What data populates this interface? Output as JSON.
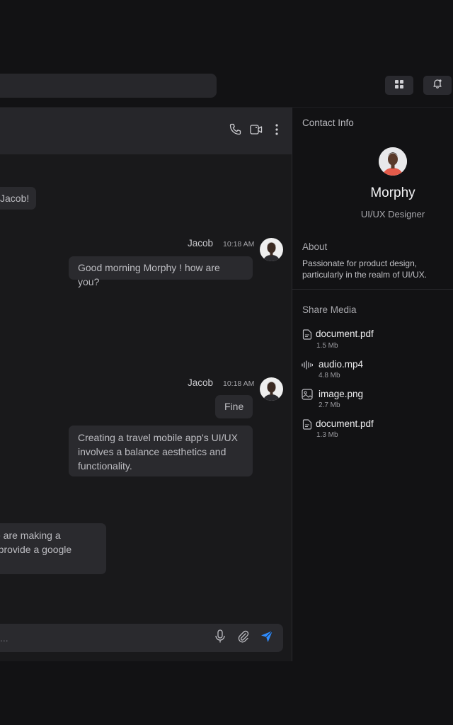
{
  "chat": {
    "messages": [
      {
        "text": "Jacob!"
      },
      {
        "sender": "Jacob",
        "time": "10:18 AM",
        "text": "Good morning Morphy ! how are you?"
      },
      {
        "sender": "Jacob",
        "time": "10:18 AM",
        "text": "Fine"
      },
      {
        "text": "Creating a travel mobile app's UI/UX involves a balance aesthetics and functionality."
      },
      {
        "line1": "ve are making a",
        "line2": "e provide a  google"
      }
    ],
    "input_placeholder": "..."
  },
  "panel": {
    "title": "Contact Info",
    "name": "Morphy",
    "role": "UI/UX Designer",
    "about_title": "About",
    "about_text": "Passionate for product design, particularly in the realm of UI/UX.",
    "media_title": "Share Media",
    "files": [
      {
        "name": "document.pdf",
        "size": "1.5 Mb",
        "icon": "document-icon"
      },
      {
        "name": "audio.mp4",
        "size": "4.8 Mb",
        "icon": "audio-icon"
      },
      {
        "name": "image.png",
        "size": "2.7 Mb",
        "icon": "image-icon"
      },
      {
        "name": "document.pdf",
        "size": "1.3 Mb",
        "icon": "document-icon"
      }
    ]
  },
  "colors": {
    "accent": "#2f8cff",
    "background": "#121214",
    "surface": "#2a2a2e"
  }
}
